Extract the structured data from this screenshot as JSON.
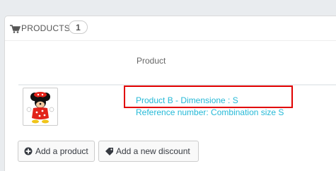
{
  "panel": {
    "title": "PRODUCTS",
    "count": "1",
    "title_icon": "shopping-cart-icon"
  },
  "table": {
    "column_header": "Product",
    "rows": [
      {
        "thumbnail": "minnie-mouse-product-image",
        "product_name": "Product B - Dimensione : S",
        "reference": "Reference number: Combination size S"
      }
    ]
  },
  "actions": {
    "add_product": {
      "label": "Add a product",
      "icon": "plus-circle-icon"
    },
    "add_discount": {
      "label": "Add a new discount",
      "icon": "tag-icon"
    }
  },
  "colors": {
    "link": "#25b9d7",
    "highlight": "#e10000"
  }
}
